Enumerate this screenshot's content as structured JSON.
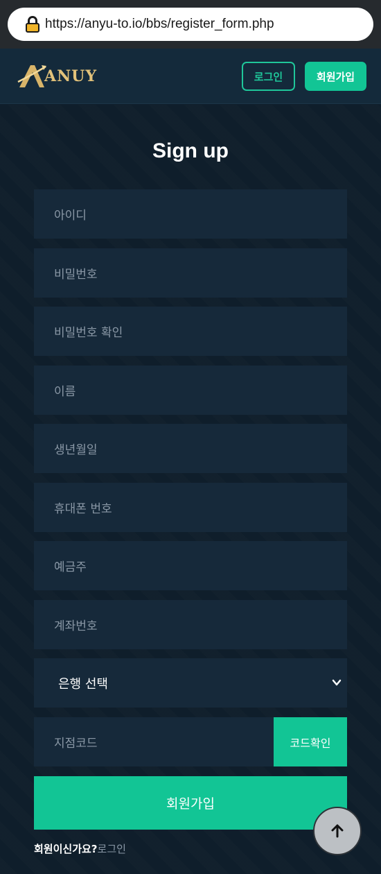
{
  "browser": {
    "url": "https://anyu-to.io/bbs/register_form.php"
  },
  "header": {
    "logo_text": "ANUY",
    "login_label": "로그인",
    "join_label": "회원가입"
  },
  "form": {
    "title": "Sign up",
    "placeholders": {
      "user_id": "아이디",
      "password": "비밀번호",
      "password_confirm": "비밀번호 확인",
      "name": "이름",
      "birthdate": "생년월일",
      "phone": "휴대폰 번호",
      "account_holder": "예금주",
      "account_number": "계좌번호",
      "branch_code": "지점코드"
    },
    "bank_select": {
      "selected": "은행 선택"
    },
    "code_check_label": "코드확인",
    "submit_label": "회원가입",
    "member_prompt": "회원이신가요?",
    "member_link": "로그인"
  },
  "colors": {
    "accent": "#12c595",
    "header_bg": "#142a3b",
    "page_bg": "#0f1e2b",
    "field_bg": "#16293a",
    "placeholder": "#8a98a6"
  },
  "icons": [
    "lock-icon",
    "logo-emblem-icon",
    "chevron-down-icon",
    "arrow-up-icon"
  ]
}
